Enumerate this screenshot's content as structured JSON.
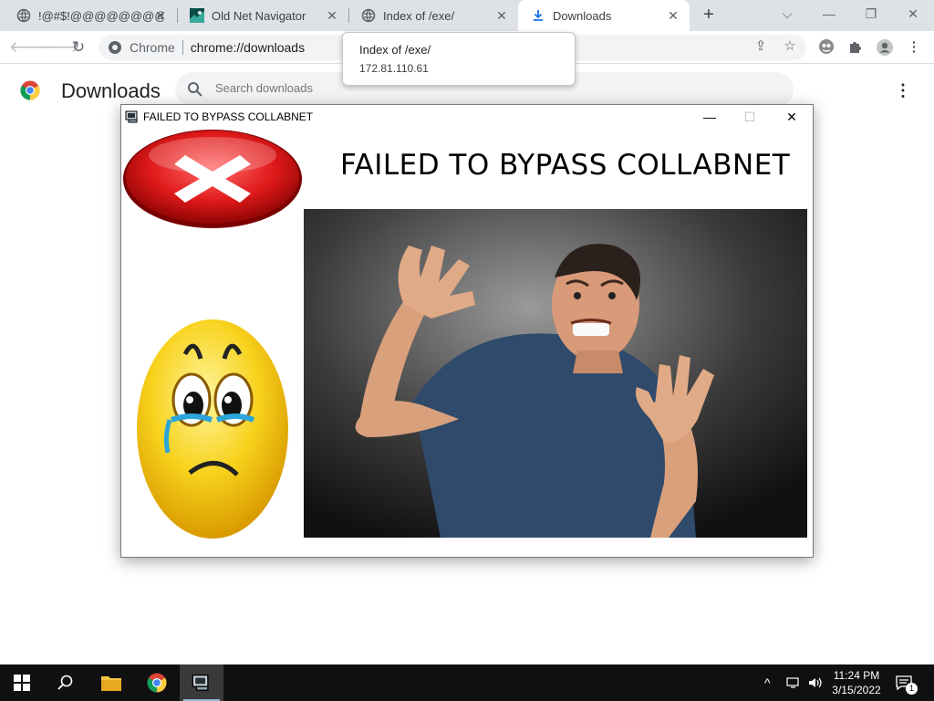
{
  "browser": {
    "tabs": [
      {
        "title": "!@#$!@@@@@@@@ I"
      },
      {
        "title": "Old Net Navigator"
      },
      {
        "title": "Index of /exe/"
      },
      {
        "title": "Downloads"
      }
    ],
    "active_tab_index": 3,
    "omnibox": {
      "chip": "Chrome",
      "url": "chrome://downloads"
    },
    "tooltip": {
      "title": "Index of /exe/",
      "subtitle": "172.81.110.61"
    }
  },
  "downloads_page": {
    "title": "Downloads",
    "search_placeholder": "Search downloads"
  },
  "popup": {
    "window_title": "FAILED TO BYPASS COLLABNET",
    "headline": "FAILED TO BYPASS COLLABNET"
  },
  "taskbar": {
    "time": "11:24 PM",
    "date": "3/15/2022",
    "notification_count": "1"
  },
  "colors": {
    "accent_blue": "#1a73e8",
    "error_red": "#d61b1b",
    "emoji_yellow": "#f7d21c"
  }
}
